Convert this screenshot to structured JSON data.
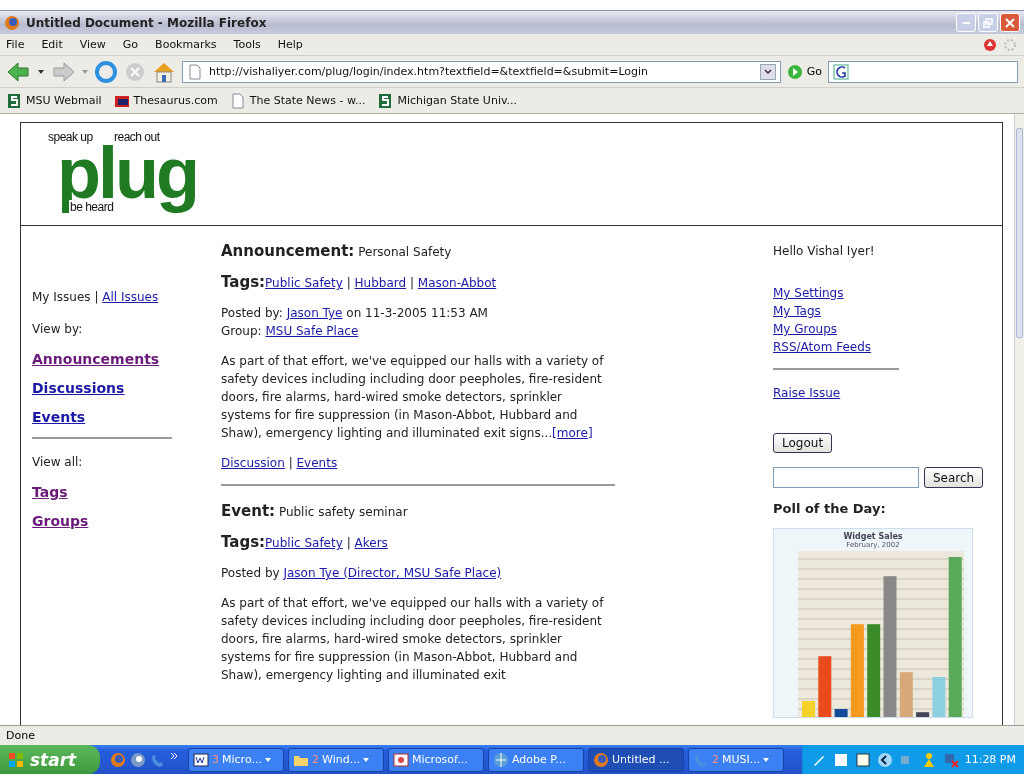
{
  "window": {
    "title": "Untitled Document - Mozilla Firefox"
  },
  "menu": [
    "File",
    "Edit",
    "View",
    "Go",
    "Bookmarks",
    "Tools",
    "Help"
  ],
  "toolbar": {
    "url": "http://vishaliyer.com/plug/login/index.htm?textfield=&textfield=&submit=Login",
    "go_label": "Go"
  },
  "bookmarks": [
    {
      "kind": "msu",
      "label": "MSU Webmail"
    },
    {
      "kind": "book",
      "label": "Thesaurus.com"
    },
    {
      "kind": "page",
      "label": "The State News - w..."
    },
    {
      "kind": "msu",
      "label": "Michigan State Univ..."
    }
  ],
  "page": {
    "logo": {
      "top_left": "speak up",
      "top_right": "reach out",
      "bottom": "be heard",
      "word": "plug"
    },
    "left_nav": {
      "my_issues": "My Issues",
      "separator": "|",
      "all_issues": "All Issues",
      "view_by": "View by:",
      "view_by_links": [
        {
          "label": "Announcements",
          "visited": true
        },
        {
          "label": "Discussions",
          "visited": false
        },
        {
          "label": "Events",
          "visited": false
        }
      ],
      "view_all": "View all:",
      "view_all_links": [
        {
          "label": "Tags",
          "visited": true
        },
        {
          "label": "Groups",
          "visited": true
        }
      ]
    },
    "posts": [
      {
        "type_label": "Announcement:",
        "title": "Personal Safety",
        "tags_label": "Tags:",
        "separator": "|",
        "tags": [
          "Public Safety",
          "Hubbard",
          "Mason-Abbot"
        ],
        "posted_prefix": "Posted by:",
        "author": "Jason Tye",
        "posted_suffix": "on 11-3-2005 11:53 AM",
        "group_prefix": "Group:",
        "group": "MSU Safe Place",
        "body": "As part of that effort, we've equipped our halls with a variety of safety devices including including door peepholes, fire-resident doors, fire alarms, hard-wired smoke detectors, sprinkler systems for fire suppression (in Mason-Abbot, Hubbard and Shaw), emergency lighting and illuminated exit signs...",
        "more": "[more]",
        "links": [
          "Discussion",
          "Events"
        ]
      },
      {
        "type_label": "Event:",
        "title": "Public safety seminar",
        "tags_label": "Tags:",
        "separator": "|",
        "tags": [
          "Public Safety",
          "Akers"
        ],
        "posted_prefix": "Posted by",
        "author": "Jason Tye (Director, MSU Safe Place)",
        "body": "As part of that effort, we've equipped our halls with a variety of safety devices including including door peepholes, fire-resident doors, fire alarms, hard-wired smoke detectors, sprinkler systems for fire suppression (in Mason-Abbot, Hubbard and Shaw), emergency lighting and illuminated exit"
      }
    ],
    "right": {
      "greeting": "Hello Vishal Iyer!",
      "links": [
        "My Settings",
        "My Tags",
        "My Groups",
        "RSS/Atom Feeds"
      ],
      "raise_issue": "Raise Issue",
      "logout": "Logout",
      "search_button": "Search",
      "poll_title": "Poll of the Day:",
      "chart_title": "Widget Sales",
      "chart_subtitle": "February, 2002"
    }
  },
  "status": "Done",
  "taskbar": {
    "start": "start",
    "tasks": [
      {
        "kind": "word",
        "count": "3",
        "label": "Micro...",
        "grouped": true,
        "selected": false
      },
      {
        "kind": "folder",
        "count": "2",
        "label": "Wind...",
        "grouped": true,
        "selected": false
      },
      {
        "kind": "ppt",
        "label": "Microsof...",
        "grouped": false,
        "selected": false
      },
      {
        "kind": "adobe",
        "label": "Adobe P...",
        "grouped": false,
        "selected": false
      },
      {
        "kind": "firefox",
        "label": "Untitled ...",
        "grouped": false,
        "selected": true
      },
      {
        "kind": "phone",
        "count": "2",
        "label": "MUSI...",
        "grouped": true,
        "selected": false
      }
    ],
    "clock": "11:28 PM"
  }
}
